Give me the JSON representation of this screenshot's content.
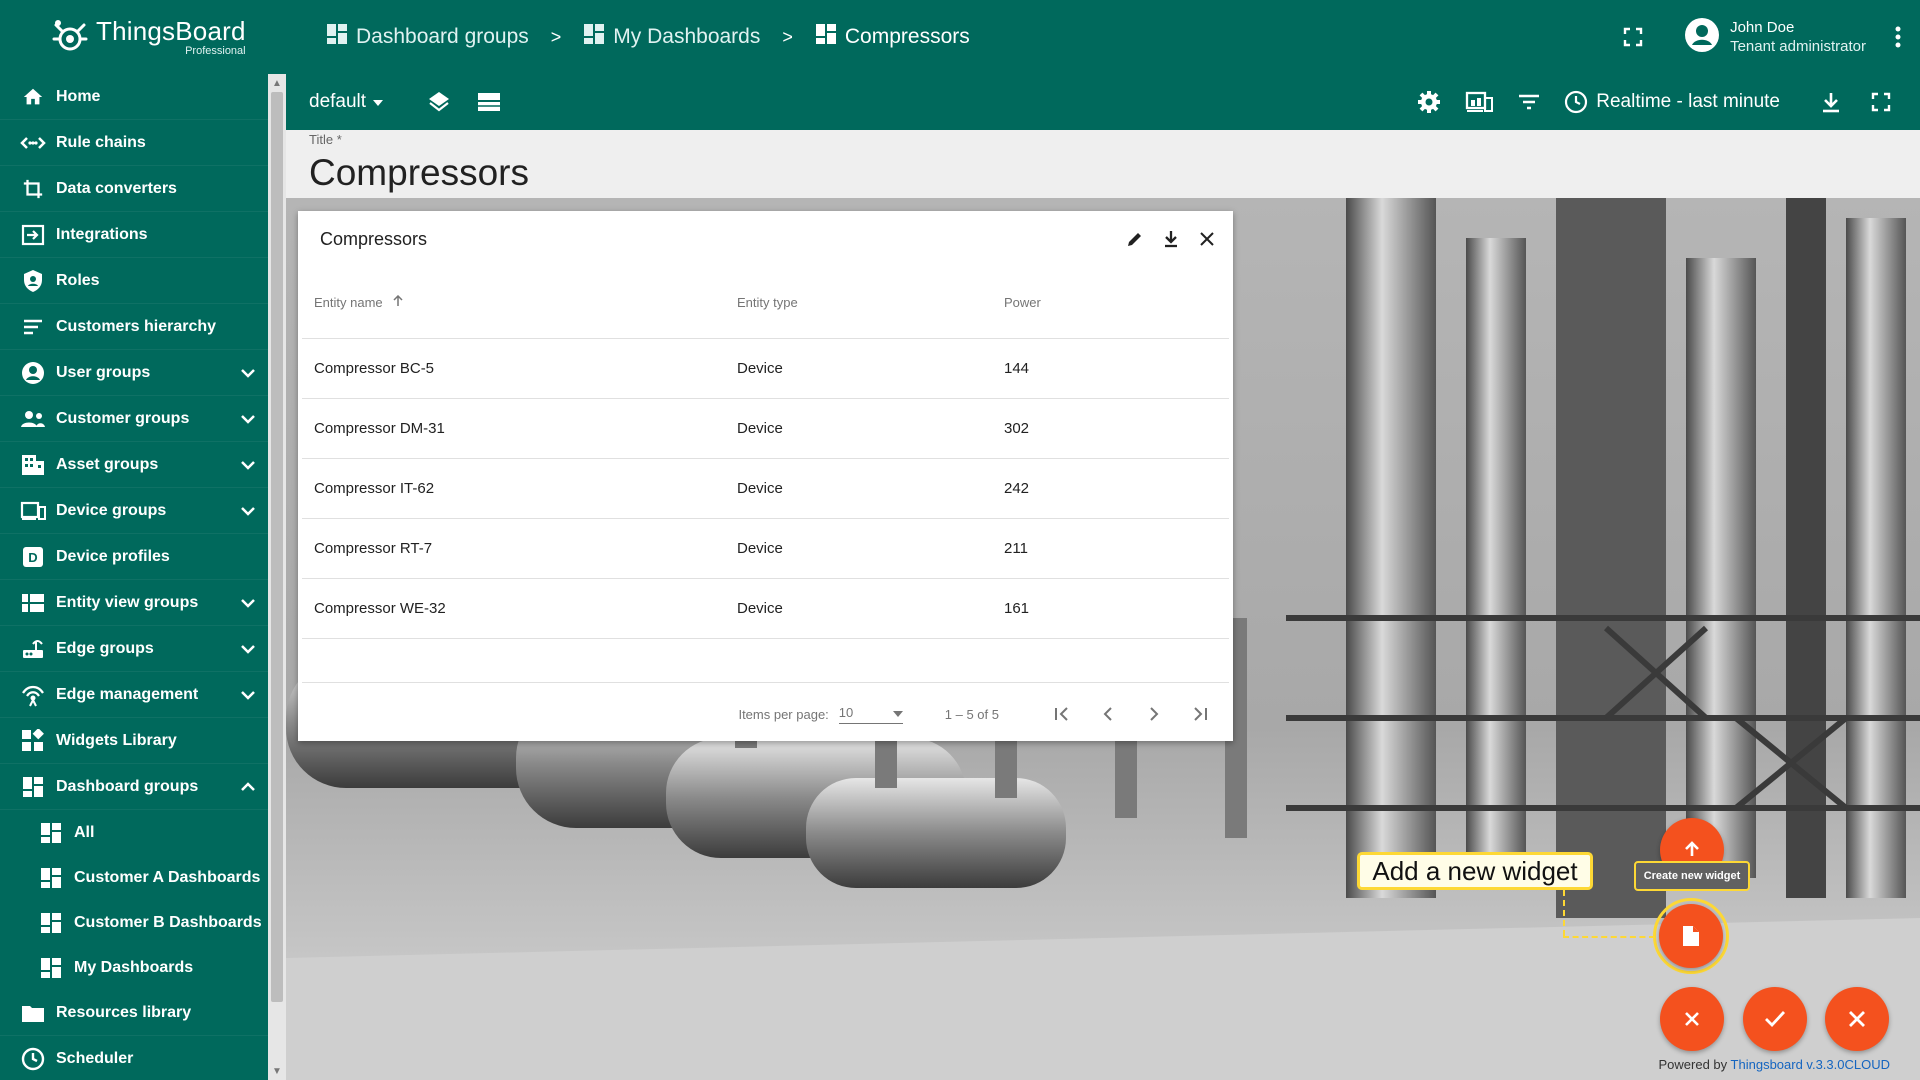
{
  "brand": {
    "name": "ThingsBoard",
    "edition": "Professional"
  },
  "sidebar": {
    "items": [
      {
        "label": "Home",
        "icon": "home-icon",
        "expandable": false
      },
      {
        "label": "Rule chains",
        "icon": "rule-chains-icon",
        "expandable": false
      },
      {
        "label": "Data converters",
        "icon": "data-converters-icon",
        "expandable": false
      },
      {
        "label": "Integrations",
        "icon": "integrations-icon",
        "expandable": false
      },
      {
        "label": "Roles",
        "icon": "roles-shield-icon",
        "expandable": false
      },
      {
        "label": "Customers hierarchy",
        "icon": "customers-hierarchy-icon",
        "expandable": false
      },
      {
        "label": "User groups",
        "icon": "user-groups-icon",
        "expandable": true
      },
      {
        "label": "Customer groups",
        "icon": "customer-groups-icon",
        "expandable": true
      },
      {
        "label": "Asset groups",
        "icon": "asset-groups-icon",
        "expandable": true
      },
      {
        "label": "Device groups",
        "icon": "device-groups-icon",
        "expandable": true
      },
      {
        "label": "Device profiles",
        "icon": "device-profiles-icon",
        "expandable": false
      },
      {
        "label": "Entity view groups",
        "icon": "entity-view-groups-icon",
        "expandable": true
      },
      {
        "label": "Edge groups",
        "icon": "edge-groups-icon",
        "expandable": true
      },
      {
        "label": "Edge management",
        "icon": "edge-management-icon",
        "expandable": true
      },
      {
        "label": "Widgets Library",
        "icon": "widgets-library-icon",
        "expandable": false
      },
      {
        "label": "Dashboard groups",
        "icon": "dashboard-groups-icon",
        "expandable": true,
        "expanded": true
      }
    ],
    "dashboard_subitems": [
      {
        "label": "All"
      },
      {
        "label": "Customer A Dashboards"
      },
      {
        "label": "Customer B Dashboards"
      },
      {
        "label": "My Dashboards"
      }
    ],
    "bottom_items": [
      {
        "label": "Resources library",
        "icon": "folder-icon"
      },
      {
        "label": "Scheduler",
        "icon": "clock-icon"
      }
    ]
  },
  "breadcrumb": [
    {
      "label": "Dashboard groups"
    },
    {
      "label": "My Dashboards"
    },
    {
      "label": "Compressors"
    }
  ],
  "breadcrumb_separator": ">",
  "user": {
    "name": "John Doe",
    "role": "Tenant administrator"
  },
  "toolbar": {
    "state": "default",
    "timewindow": "Realtime - last minute"
  },
  "title_field": {
    "label": "Title *",
    "value": "Compressors"
  },
  "widget": {
    "title": "Compressors",
    "columns": {
      "name": "Entity name",
      "type": "Entity type",
      "power": "Power"
    },
    "rows": [
      {
        "name": "Compressor BC-5",
        "type": "Device",
        "power": "144"
      },
      {
        "name": "Compressor DM-31",
        "type": "Device",
        "power": "302"
      },
      {
        "name": "Compressor IT-62",
        "type": "Device",
        "power": "242"
      },
      {
        "name": "Compressor RT-7",
        "type": "Device",
        "power": "211"
      },
      {
        "name": "Compressor WE-32",
        "type": "Device",
        "power": "161"
      }
    ],
    "pager": {
      "items_per_page_label": "Items per page:",
      "items_per_page": "10",
      "range": "1 – 5 of 5"
    }
  },
  "fabs": {
    "tooltip": "Create new widget"
  },
  "callout": {
    "text": "Add a new widget"
  },
  "footer": {
    "prefix": "Powered by",
    "link": "Thingsboard v.3.3.0CLOUD"
  },
  "colors": {
    "primary": "#00695c",
    "accent": "#f4511e",
    "highlight": "#fdd835"
  }
}
